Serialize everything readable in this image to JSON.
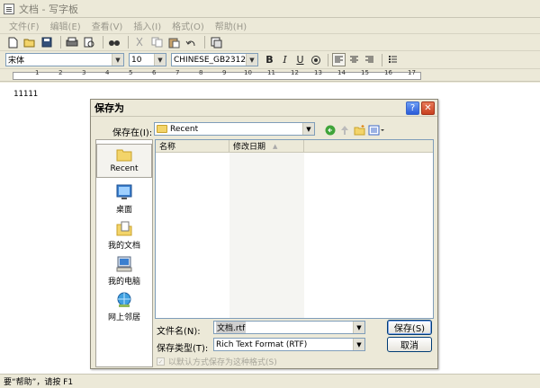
{
  "window": {
    "title": "文档 - 写字板"
  },
  "menu": [
    "文件(F)",
    "编辑(E)",
    "查看(V)",
    "插入(I)",
    "格式(O)",
    "帮助(H)"
  ],
  "toolbar_icons": [
    "new-icon",
    "open-icon",
    "save-icon",
    "print-icon",
    "print-preview-icon",
    "find-icon",
    "cut-icon",
    "copy-icon",
    "paste-icon",
    "undo-icon",
    "date-time-icon"
  ],
  "format": {
    "font": "宋体",
    "size": "10",
    "script": "CHINESE_GB2312",
    "bold": "B",
    "italic": "I",
    "underline": "U"
  },
  "ruler_marks": [
    "1",
    "2",
    "3",
    "4",
    "5",
    "6",
    "7",
    "8",
    "9",
    "10",
    "11",
    "12",
    "13",
    "14",
    "15",
    "16",
    "17"
  ],
  "document": {
    "text": "11111"
  },
  "status": {
    "text": "要“帮助”，请按 F1"
  },
  "dialog": {
    "title": "保存为",
    "help": "?",
    "close": "✕",
    "lookin_label": "保存在(I):",
    "lookin_value": "Recent",
    "columns": [
      "名称",
      "修改日期"
    ],
    "places": [
      "Recent",
      "桌面",
      "我的文档",
      "我的电脑",
      "网上邻居"
    ],
    "filename_label": "文件名(N):",
    "filename_value": "文档.rtf",
    "filetype_label": "保存类型(T):",
    "filetype_value": "Rich Text Format (RTF)",
    "save_button": "保存(S)",
    "cancel_button": "取消",
    "default_format_checkbox": "以默认方式保存为这种格式(S)"
  }
}
